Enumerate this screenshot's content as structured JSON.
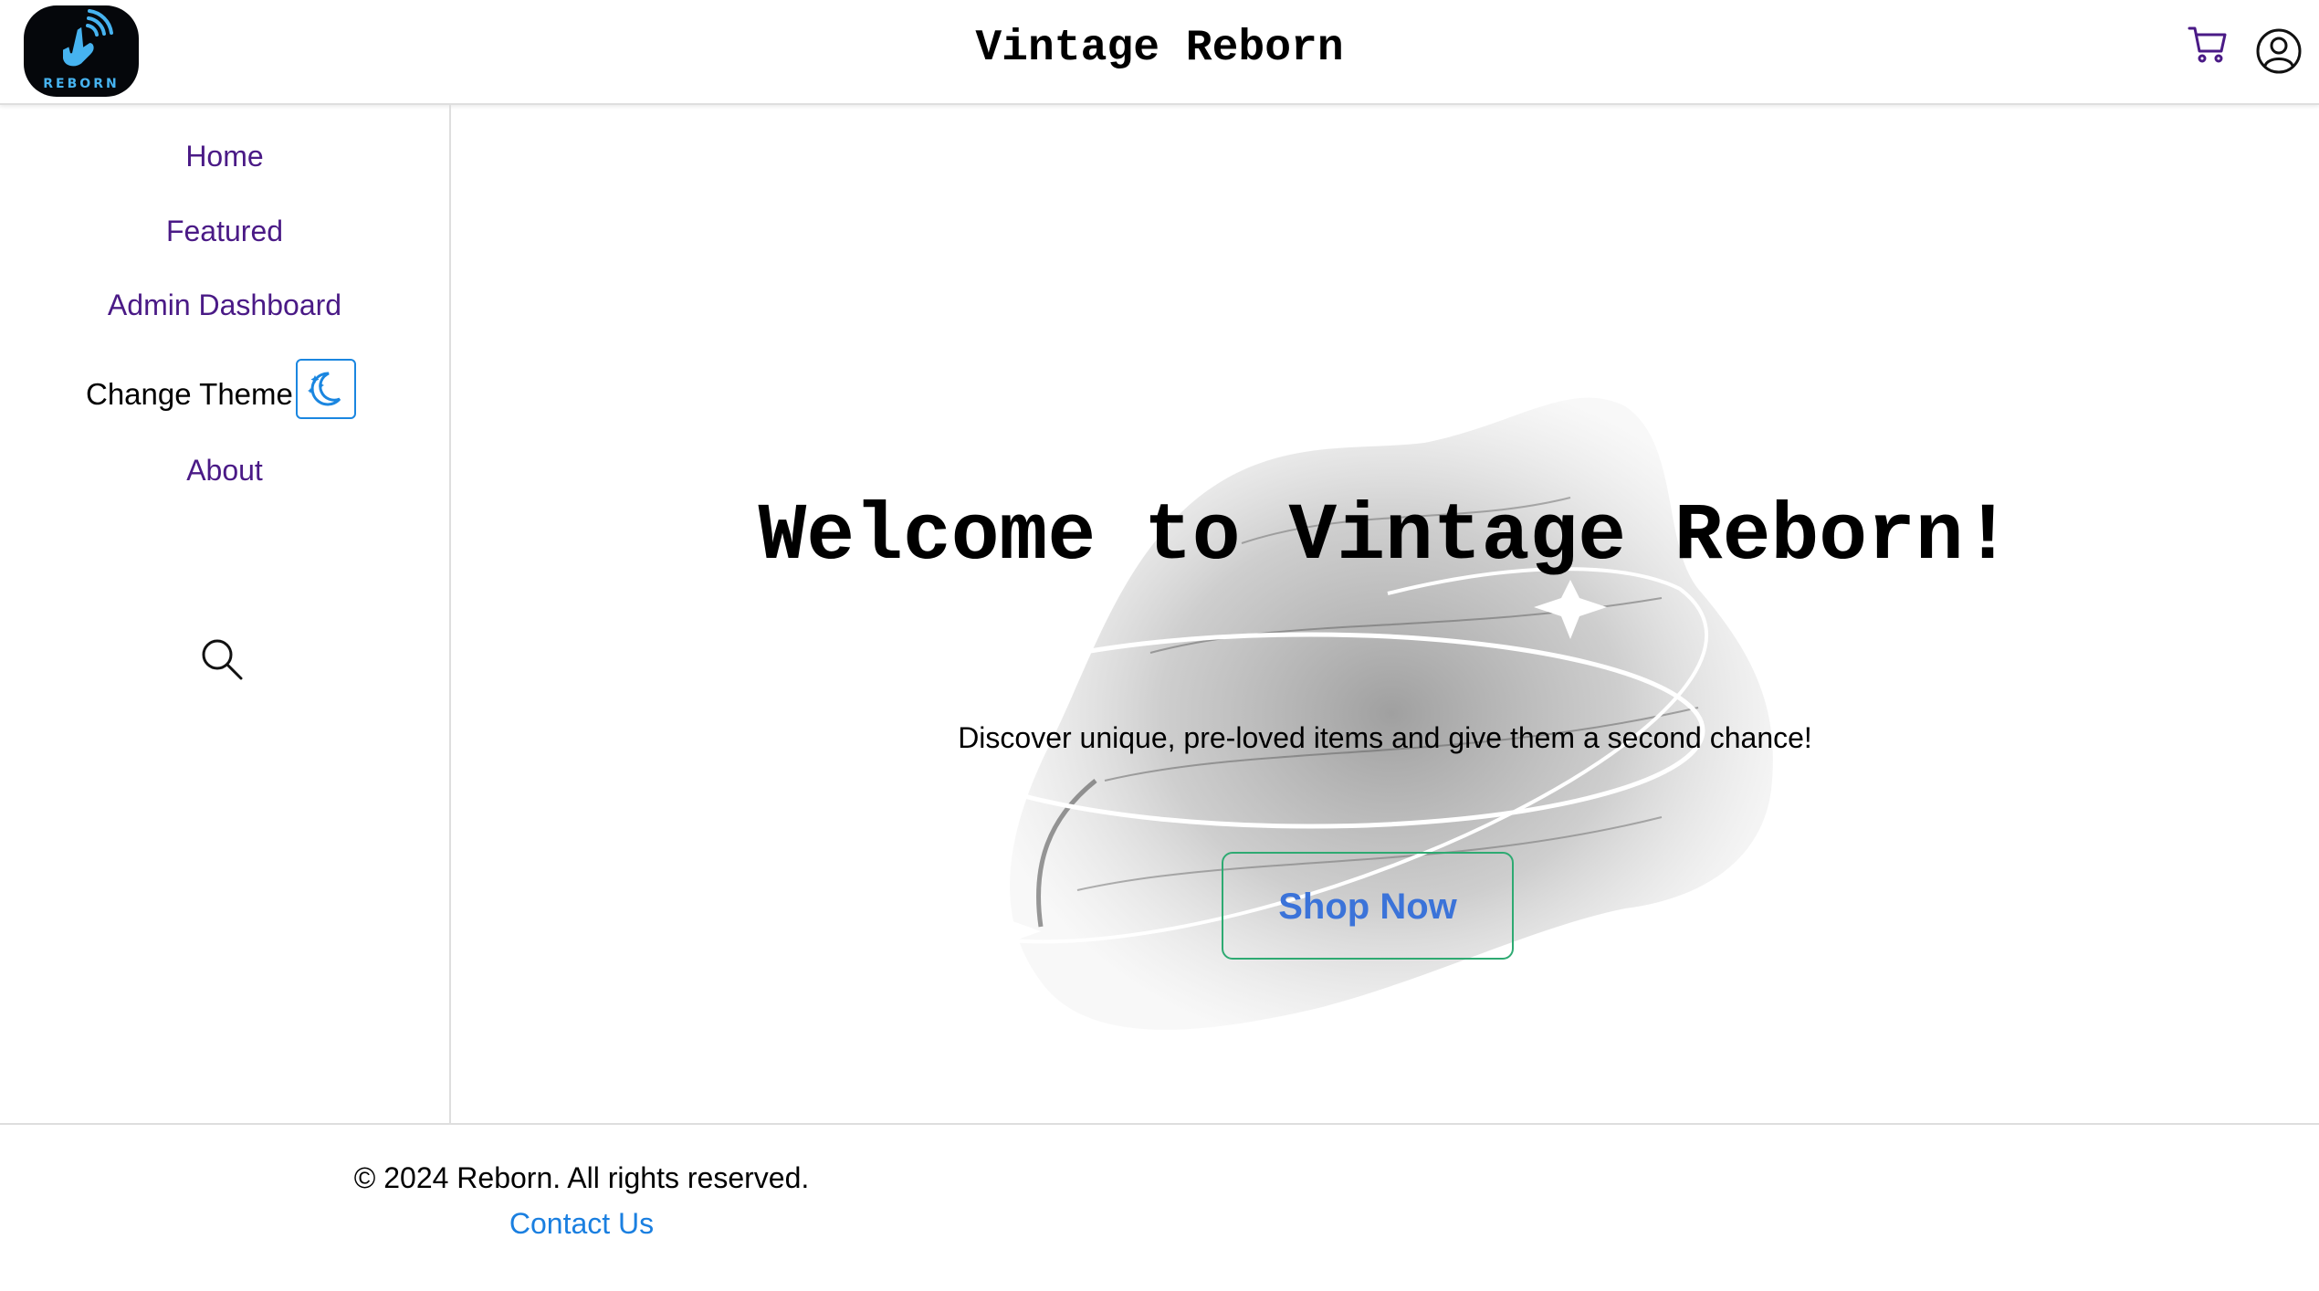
{
  "header": {
    "logo_text": "REBORN",
    "title": "Vintage Reborn",
    "cart_icon": "shopping-cart-icon",
    "account_icon": "user-circle-icon"
  },
  "sidebar": {
    "items": [
      {
        "label": "Home"
      },
      {
        "label": "Featured"
      },
      {
        "label": "Admin Dashboard"
      },
      {
        "label": "About"
      }
    ],
    "theme_label": "Change Theme",
    "theme_icon": "moon-stars-icon",
    "search_icon": "search-icon"
  },
  "hero": {
    "title": "Welcome to Vintage Reborn!",
    "subtitle": "Discover unique, pre-loved items and give them a second chance!",
    "button_label": "Shop Now"
  },
  "footer": {
    "copyright": "© 2024 Reborn. All rights reserved.",
    "contact_label": "Contact Us"
  },
  "colors": {
    "nav_link": "#4a1a86",
    "accent_blue": "#1a7fe0",
    "button_border": "#2eaa72",
    "button_text": "#3b73d9"
  }
}
